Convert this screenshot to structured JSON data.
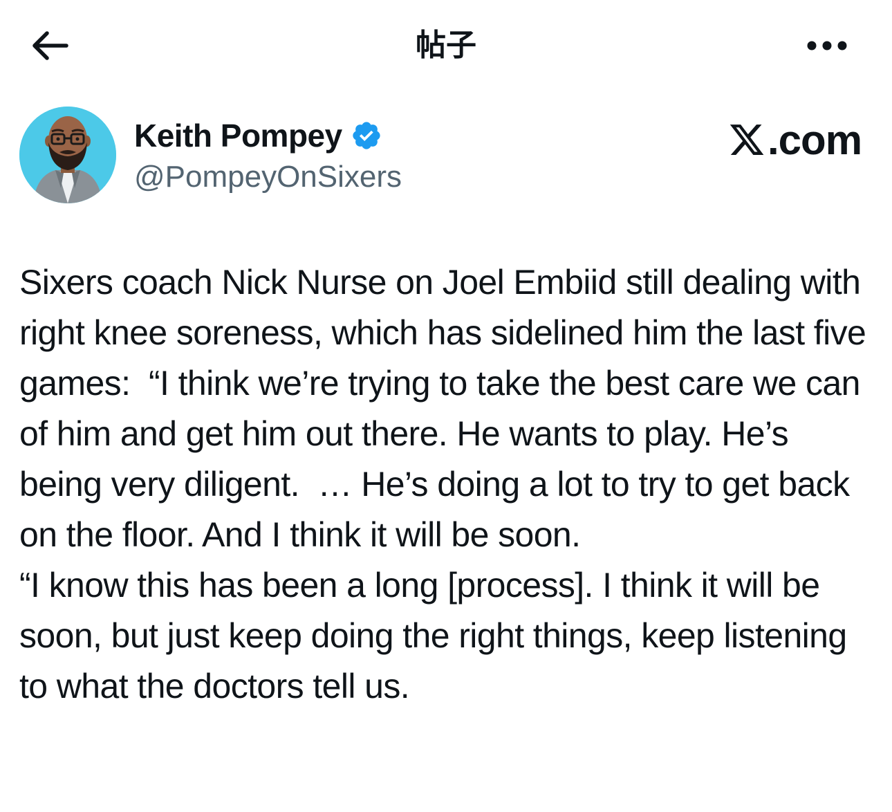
{
  "header": {
    "title": "帖子",
    "back_icon": "arrow-left-icon",
    "more_icon": "ellipsis-horizontal-icon"
  },
  "author": {
    "name": "Keith Pompey",
    "handle": "@PompeyOnSixers",
    "verified": true,
    "verified_color": "#1d9bf0"
  },
  "source": {
    "label": ".com",
    "logo_icon": "x-logo-icon"
  },
  "post": {
    "paragraphs": [
      "Sixers coach Nick Nurse on Joel Embiid still dealing with right knee soreness, which has sidelined him the last five games:  “I think we’re trying to take the best care we can of him and get him out there. He wants to play. He’s being very diligent.  … He’s doing a lot to try to get back on the floor. And I think it will be soon.",
      "“I know this has been a long [process]. I think it will be soon, but just keep doing the right things, keep listening to what the doctors tell us."
    ]
  },
  "colors": {
    "text_primary": "#0f1419",
    "text_secondary": "#536471",
    "avatar_bg": "#4cc9e8"
  }
}
